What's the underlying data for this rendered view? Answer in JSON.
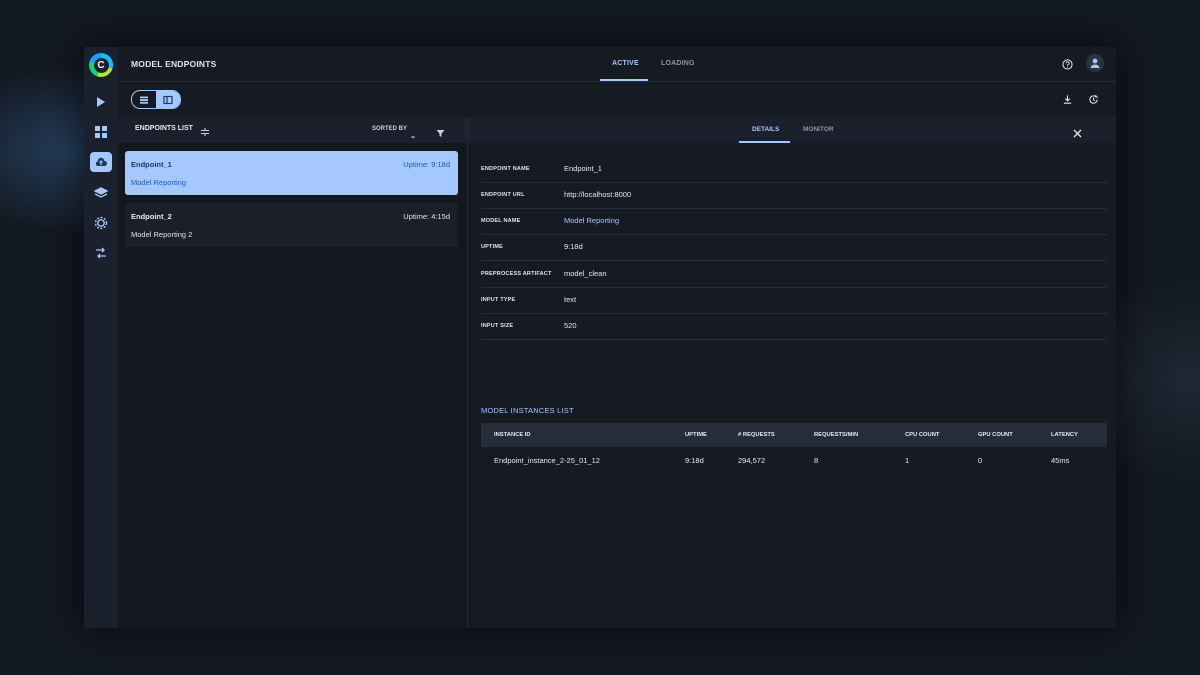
{
  "header": {
    "title": "MODEL ENDPOINTS",
    "tabs": [
      {
        "label": "ACTIVE",
        "active": true
      },
      {
        "label": "LOADING",
        "active": false
      }
    ]
  },
  "sidebar": {
    "logo_letter": "C",
    "items": [
      {
        "icon": "play-icon"
      },
      {
        "icon": "grid-icon"
      },
      {
        "icon": "cloud-upload-icon",
        "active": true
      },
      {
        "icon": "layers-icon"
      },
      {
        "icon": "gear-icon"
      },
      {
        "icon": "pipeline-icon"
      }
    ]
  },
  "toolbar": {
    "view_toggle": [
      "table-view-icon",
      "split-view-icon"
    ],
    "selected_view": "split-view-icon",
    "right_icons": [
      "download-icon",
      "refresh-icon"
    ]
  },
  "list": {
    "title": "ENDPOINTS LIST",
    "sort_label": "SORTED BY",
    "endpoints": [
      {
        "name": "Endpoint_1",
        "uptime": "Uptime: 9:18d",
        "model": "Model Reporting",
        "selected": true
      },
      {
        "name": "Endpoint_2",
        "uptime": "Uptime: 4:15d",
        "model": "Model Reporting 2",
        "selected": false
      }
    ]
  },
  "details": {
    "tabs": [
      {
        "label": "DETAILS",
        "active": true
      },
      {
        "label": "MONITOR",
        "active": false
      }
    ],
    "fields": [
      {
        "label": "ENDPOINT NAME",
        "value": "Endpoint_1"
      },
      {
        "label": "ENDPOINT URL",
        "value": "http://localhost:8000"
      },
      {
        "label": "MODEL NAME",
        "value": "Model Reporting",
        "link": true
      },
      {
        "label": "UPTIME",
        "value": "9:18d"
      },
      {
        "label": "PREPROCESS ARTIFACT",
        "value": "model_clean"
      },
      {
        "label": "INPUT TYPE",
        "value": "text"
      },
      {
        "label": "INPUT SIZE",
        "value": "520"
      }
    ],
    "instances_title": "MODEL INSTANCES LIST",
    "instances_columns": [
      "INSTANCE ID",
      "UPTIME",
      "# REQUESTS",
      "REQUESTS/MIN",
      "CPU COUNT",
      "GPU COUNT",
      "LATENCY"
    ],
    "instances_rows": [
      [
        "Endpoint_instance_2-25_01_12",
        "9:18d",
        "294,572",
        "8",
        "1",
        "0",
        "45ms"
      ]
    ]
  },
  "colors": {
    "accent": "#a5c8ff",
    "background": "#151a23",
    "panel": "#1b212c",
    "divider": "#262d3a"
  }
}
